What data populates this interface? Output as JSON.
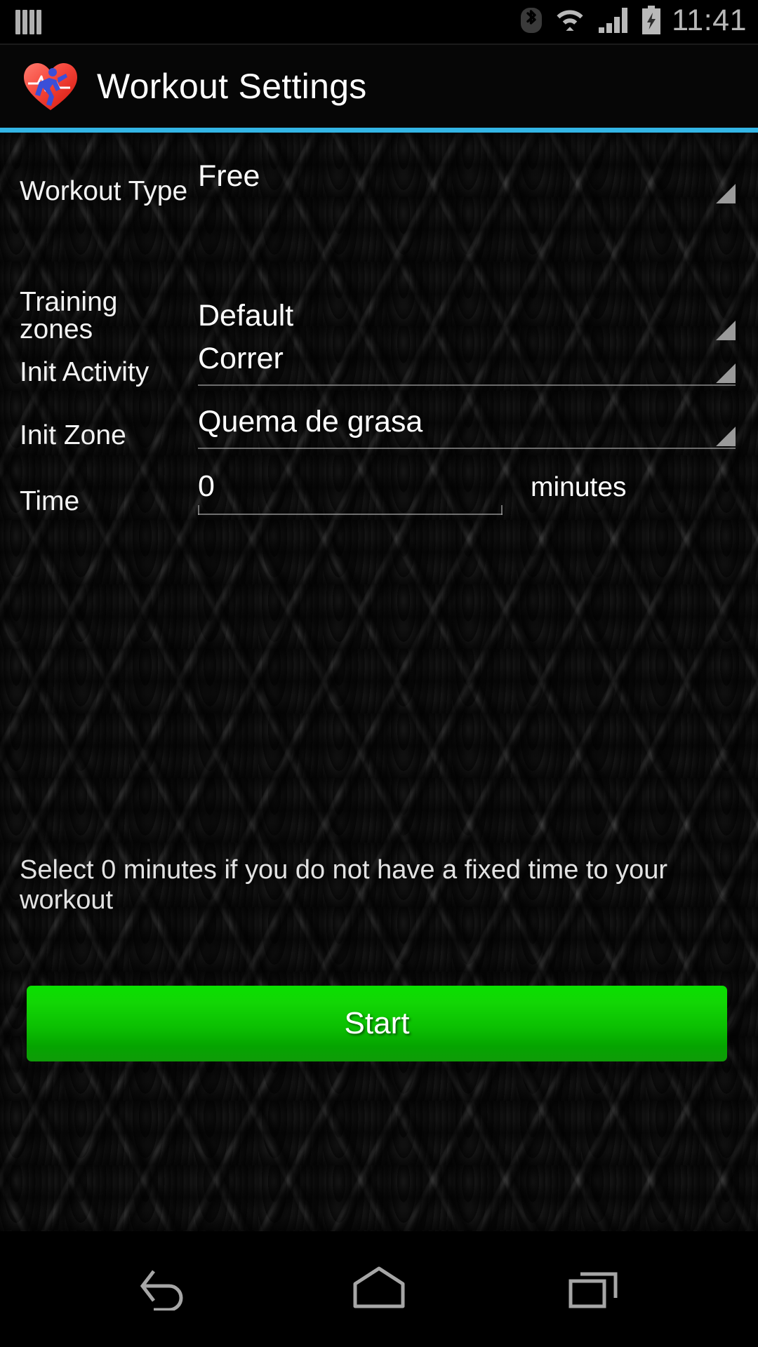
{
  "status_bar": {
    "notification_icon": "bars-icon",
    "bluetooth_icon": "bluetooth-icon",
    "wifi_icon": "wifi-icon",
    "signal_icon": "cellular-signal-icon",
    "battery_icon": "battery-charging-icon",
    "clock": "11:41"
  },
  "action_bar": {
    "app_icon": "heart-runner-icon",
    "title": "Workout Settings",
    "accent_color": "#33b5e5"
  },
  "form": {
    "workout_type": {
      "label": "Workout Type",
      "value": "Free"
    },
    "training_zones": {
      "label": "Training zones",
      "value": "Default"
    },
    "init_activity": {
      "label": "Init Activity",
      "value": "Correr"
    },
    "init_zone": {
      "label": "Init Zone",
      "value": "Quema de grasa"
    },
    "time": {
      "label": "Time",
      "value": "0",
      "placeholder": "0",
      "unit": "minutes"
    }
  },
  "hint": "Select 0 minutes if you do not have a fixed time to your workout",
  "start_button": {
    "label": "Start",
    "color": "#0bbf02"
  },
  "nav_bar": {
    "back": "back-icon",
    "home": "home-icon",
    "recents": "recents-icon"
  }
}
